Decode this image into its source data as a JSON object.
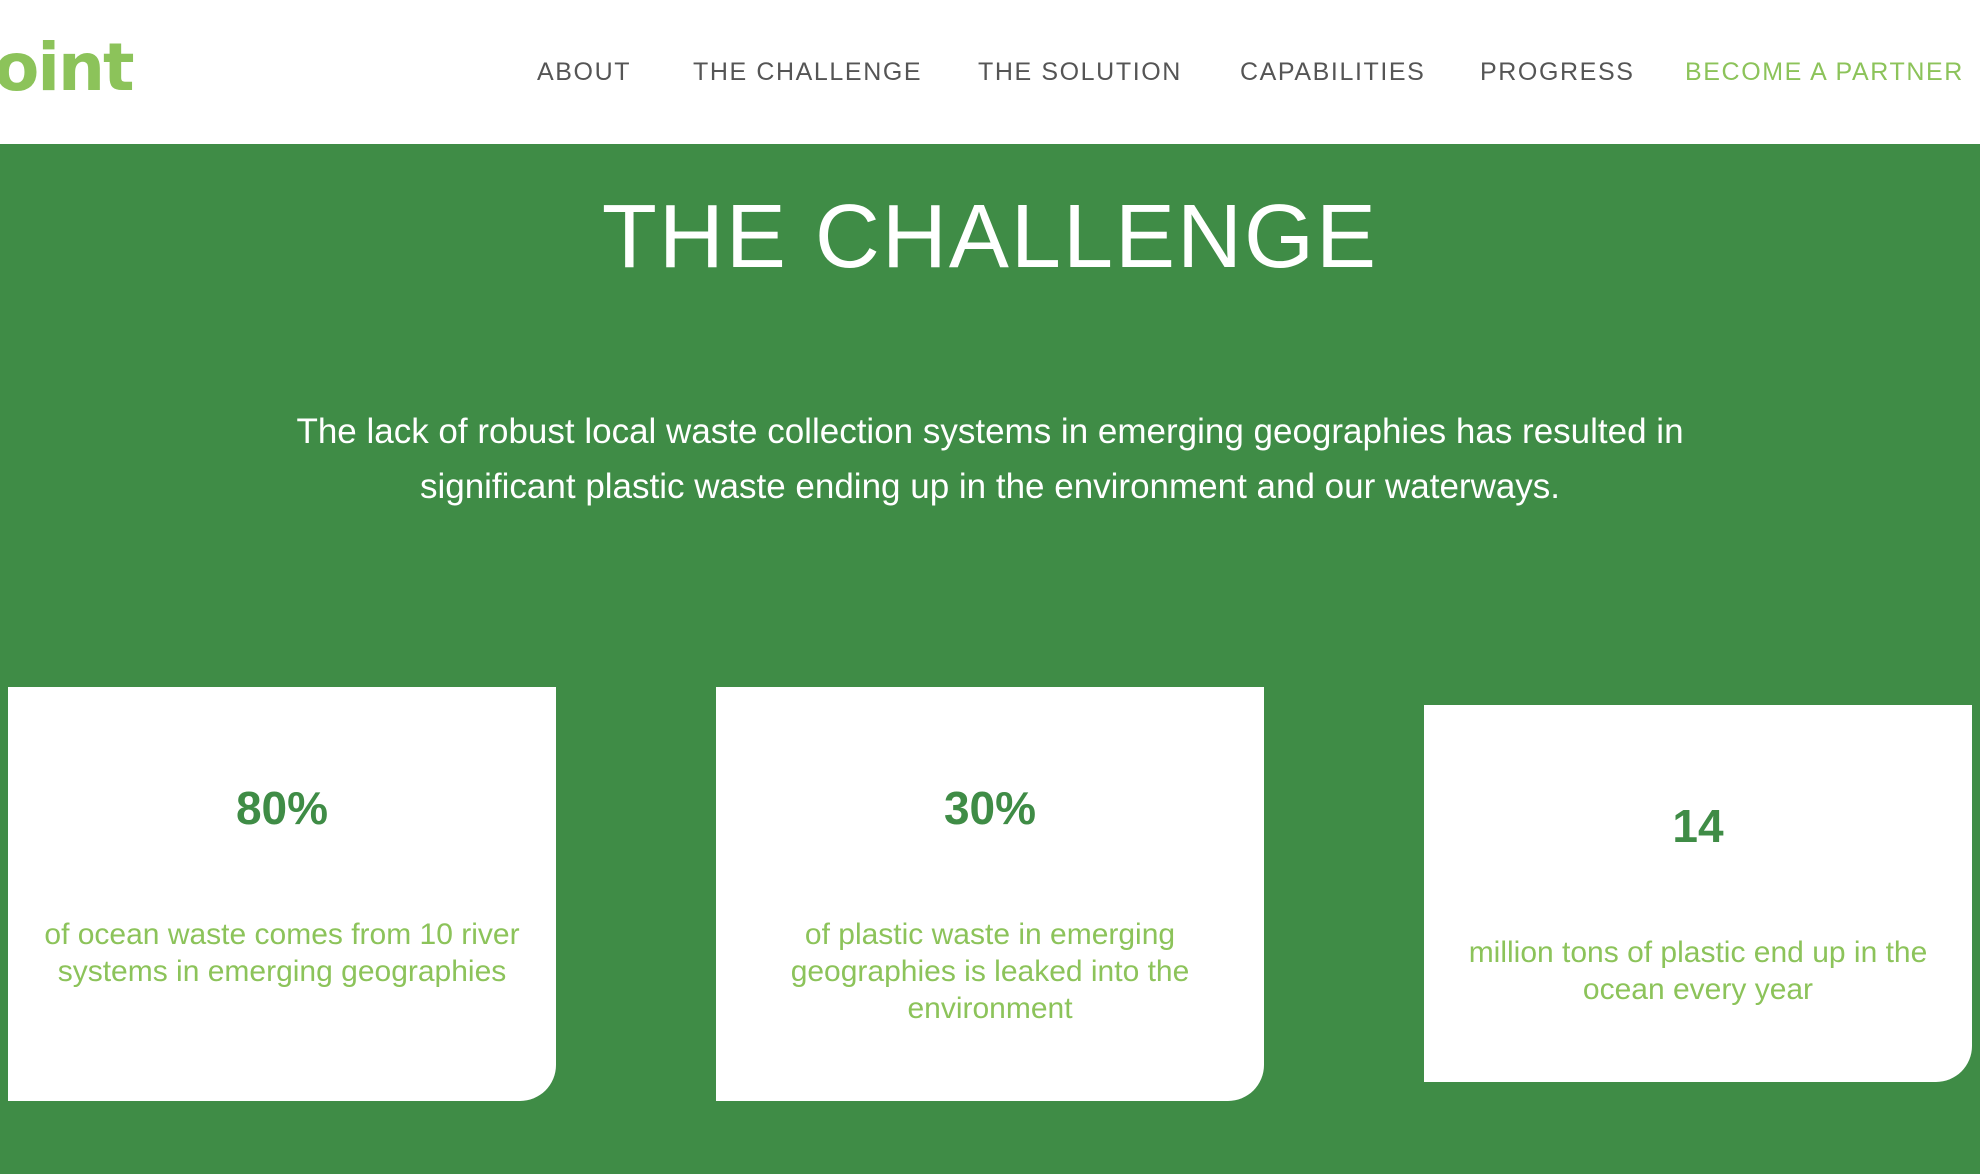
{
  "header": {
    "logo_text": "oint",
    "nav": [
      {
        "label": "ABOUT"
      },
      {
        "label": "THE CHALLENGE"
      },
      {
        "label": "THE SOLUTION"
      },
      {
        "label": "CAPABILITIES"
      },
      {
        "label": "PROGRESS"
      },
      {
        "label": "BECOME A PARTNER"
      }
    ]
  },
  "hero": {
    "title": "THE CHALLENGE",
    "intro": "The lack of robust local waste collection systems in emerging geographies has resulted in significant plastic waste ending up in the environment and our waterways."
  },
  "stats": [
    {
      "value": "80%",
      "description": "of ocean waste comes from 10 river systems in emerging geographies"
    },
    {
      "value": "30%",
      "description": "of plastic waste in emerging geographies is leaked into the environment"
    },
    {
      "value": "14",
      "description": "million tons of plastic end up in the ocean every year"
    }
  ],
  "colors": {
    "brand_green": "#3f8c46",
    "accent_light_green": "#8cc35a",
    "nav_text": "#555555",
    "card_bg": "#ffffff"
  }
}
